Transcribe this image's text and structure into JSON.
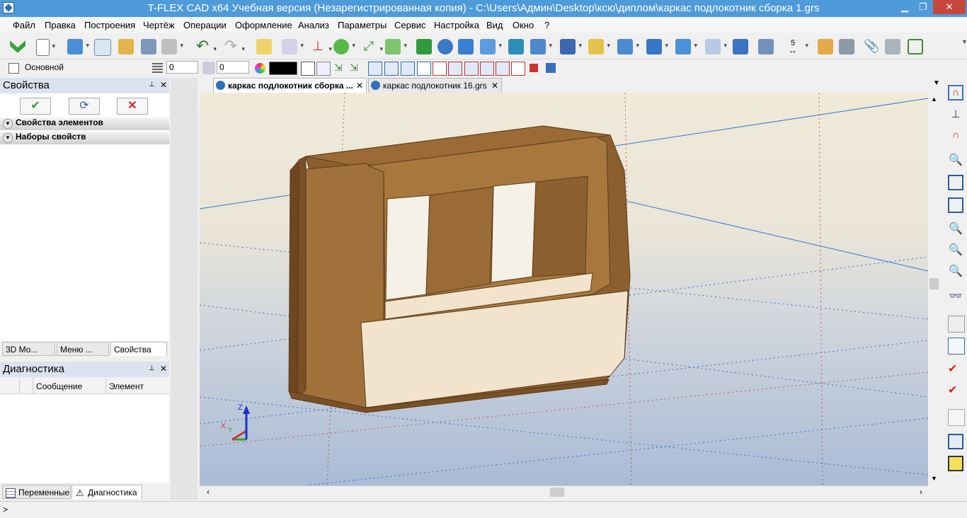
{
  "window": {
    "title": "T-FLEX CAD x64 Учебная версия (Незарегистрированная копия) - C:\\Users\\Админ\\Desktop\\ксю\\диплом\\каркас подлокотник сборка 1.grs",
    "min_glyph": "▁",
    "max_glyph": "❐",
    "close_glyph": "✕"
  },
  "menu": [
    "Файл",
    "Правка",
    "Построения",
    "Чертёж",
    "Операции",
    "Оформление",
    "Анализ",
    "Параметры",
    "Сервис",
    "Настройка",
    "Вид",
    "Окно",
    "?"
  ],
  "toolbar2": {
    "layer_label": "Основной",
    "value1": "0",
    "value2": "0",
    "color_swatch": "#000000"
  },
  "toolbar1": {
    "step_value": "5"
  },
  "properties_panel": {
    "title": "Свойства",
    "pin_glyph": "📌",
    "close_glyph": "✕",
    "sections": [
      "Свойства элементов",
      "Наборы свойств"
    ],
    "tabs": [
      "3D Мо...",
      "Меню ...",
      "Свойства"
    ]
  },
  "diagnostics_panel": {
    "title": "Диагностика",
    "columns": [
      "",
      "Сообщение",
      "Элемент"
    ],
    "tabs": [
      "Переменные",
      "Диагностика"
    ]
  },
  "documents": {
    "tabs": [
      {
        "label": "каркас подлокотник сборка ...",
        "active": true
      },
      {
        "label": "каркас подлокотник 16.grs",
        "active": false
      }
    ]
  },
  "axes": {
    "x": "X",
    "y": "Y",
    "z": "Z"
  },
  "colors": {
    "titlebar": "#4f9ad8",
    "wood": "#a0713a",
    "panel_face": "#f2e3cc",
    "grid_line": "#2f78d6"
  },
  "status": {
    "prompt": ">"
  }
}
